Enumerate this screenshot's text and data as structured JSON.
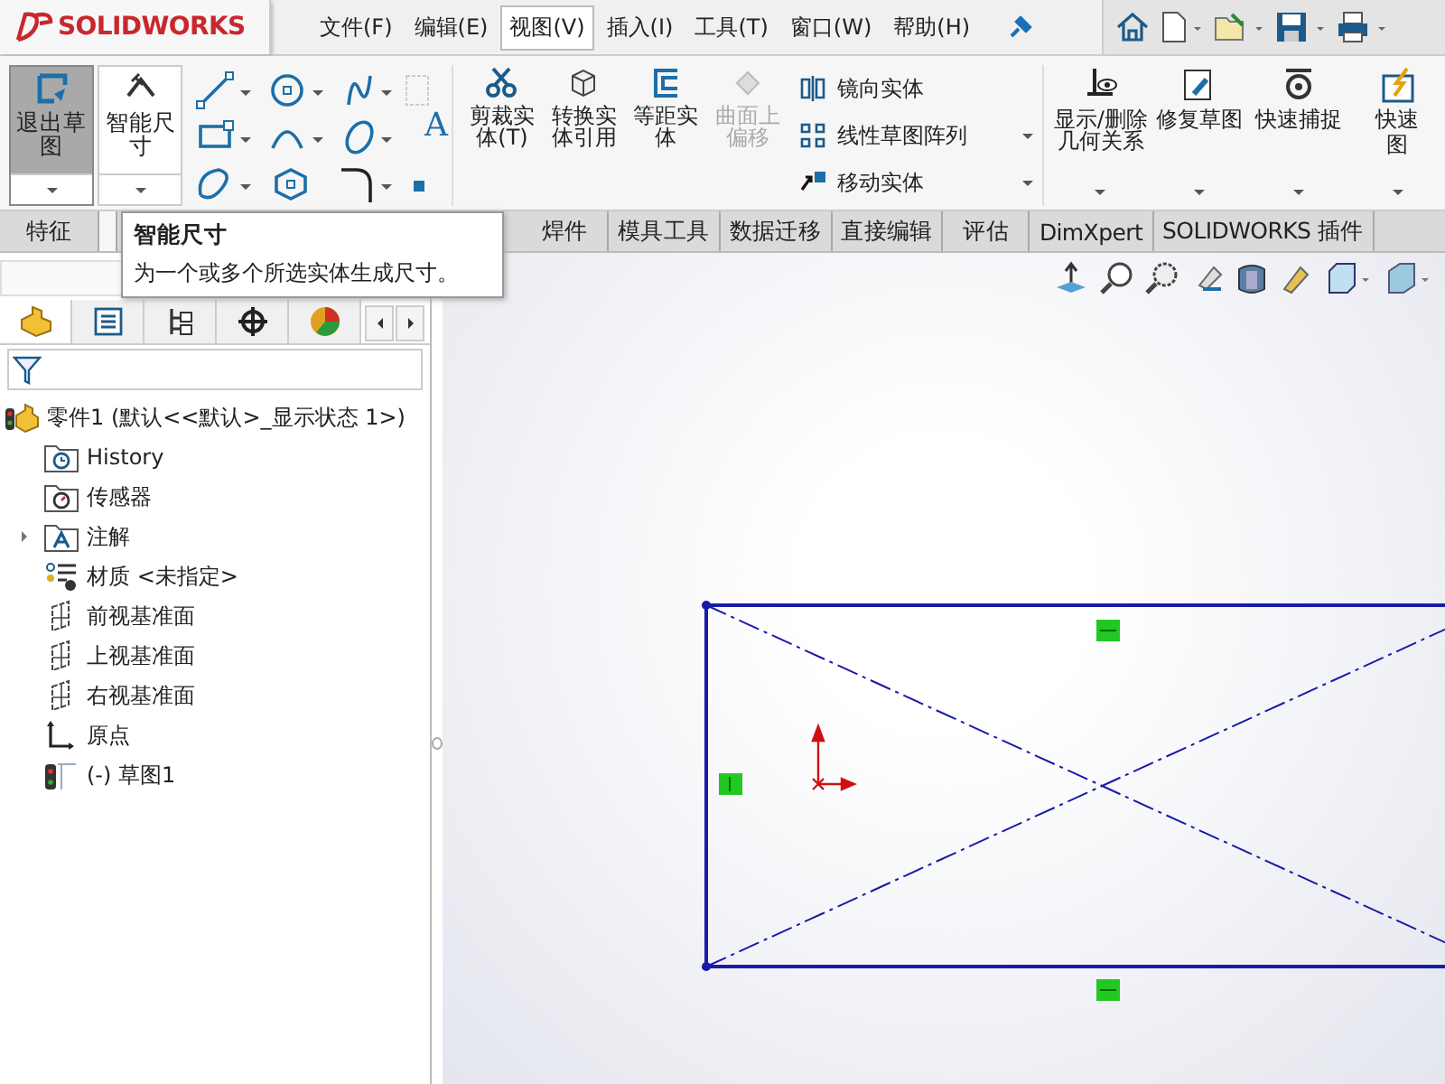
{
  "app": {
    "logo": "SOLIDWORKS"
  },
  "menu": [
    {
      "label": "文件(F)",
      "selected": false
    },
    {
      "label": "编辑(E)",
      "selected": false
    },
    {
      "label": "视图(V)",
      "selected": true
    },
    {
      "label": "插入(I)",
      "selected": false
    },
    {
      "label": "工具(T)",
      "selected": false
    },
    {
      "label": "窗口(W)",
      "selected": false
    },
    {
      "label": "帮助(H)",
      "selected": false
    }
  ],
  "ribbon": {
    "large_buttons": [
      {
        "label": "退出草图",
        "selected": true
      },
      {
        "label": "智能尺寸",
        "selected": false
      }
    ],
    "tools": [
      {
        "label": "剪裁实体(T)",
        "kind": "trim",
        "disabled": false
      },
      {
        "label": "转换实体引用",
        "kind": "convert",
        "disabled": false
      },
      {
        "label": "等距实体",
        "kind": "offset",
        "disabled": false
      },
      {
        "label": "曲面上偏移",
        "kind": "surface",
        "disabled": true
      }
    ],
    "list_tools": [
      {
        "label": "镜向实体",
        "kind": "mirror"
      },
      {
        "label": "线性草图阵列",
        "kind": "pattern"
      },
      {
        "label": "移动实体",
        "kind": "move"
      }
    ],
    "tools_2": [
      {
        "label": "显示/删除几何关系",
        "kind": "relations"
      },
      {
        "label": "修复草图",
        "kind": "repair"
      },
      {
        "label": "快速捕捉",
        "kind": "snap"
      },
      {
        "lines": [
          "快速",
          "图"
        ],
        "kind": "quick"
      }
    ],
    "text_tool": "A"
  },
  "tabs": [
    {
      "label": "特征",
      "selected": false
    },
    {
      "selected": true
    },
    {
      "label": "焊件",
      "selected": false
    },
    {
      "label": "模具工具",
      "selected": false
    },
    {
      "label": "数据迁移",
      "selected": false
    },
    {
      "label": "直接编辑",
      "selected": false
    },
    {
      "label": "评估",
      "selected": false
    },
    {
      "label": "DimXpert",
      "selected": false
    },
    {
      "label": "SOLIDWORKS 插件",
      "selected": false
    }
  ],
  "tooltip": {
    "title": "智能尺寸",
    "text": "为一个或多个所选实体生成尺寸。"
  },
  "feature_manager": {
    "tabs": [
      {
        "kind": "feature",
        "selected": true
      },
      {
        "kind": "property",
        "selected": false
      },
      {
        "kind": "config",
        "selected": false
      },
      {
        "kind": "dim",
        "selected": false
      },
      {
        "kind": "display",
        "selected": false
      }
    ],
    "tree": {
      "label": "零件1  (默认<<默认>_显示状态 1>)",
      "children": [
        {
          "label": "History",
          "kind": "history"
        },
        {
          "label": "传感器",
          "kind": "sensor"
        },
        {
          "label": "注解",
          "kind": "annotation",
          "expanded": false
        },
        {
          "label": "材质 <未指定>",
          "kind": "material"
        },
        {
          "label": "前视基准面",
          "kind": "plane"
        },
        {
          "label": "上视基准面",
          "kind": "plane"
        },
        {
          "label": "右视基准面",
          "kind": "plane"
        },
        {
          "label": "原点",
          "kind": "origin"
        },
        {
          "label": "(-) 草图1",
          "kind": "sketch"
        }
      ]
    }
  }
}
